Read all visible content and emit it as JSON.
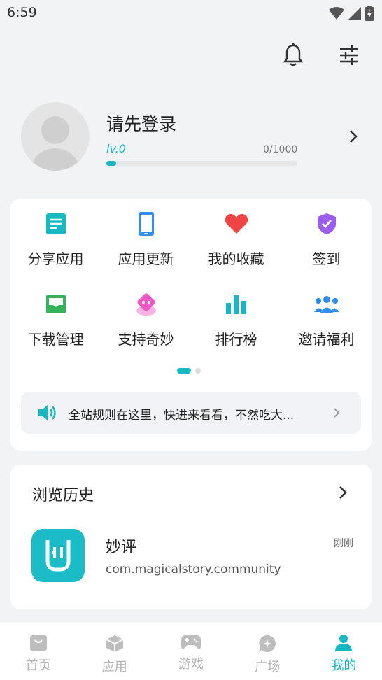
{
  "status": {
    "time": "6:59"
  },
  "profile": {
    "name": "请先登录",
    "level": "lv.0",
    "exp": "0/1000",
    "progress": 0.05
  },
  "grid": {
    "items": [
      {
        "label": "分享应用",
        "icon": "share-doc-icon",
        "color": "#16b8c3"
      },
      {
        "label": "应用更新",
        "icon": "phone-icon",
        "color": "#2f8ef0"
      },
      {
        "label": "我的收藏",
        "icon": "heart-icon",
        "color": "#f04545"
      },
      {
        "label": "签到",
        "icon": "check-badge-icon",
        "color": "#9b5cf0"
      },
      {
        "label": "下载管理",
        "icon": "download-tray-icon",
        "color": "#34b35b"
      },
      {
        "label": "支持奇妙",
        "icon": "gift-icon",
        "color": "#ee58c4"
      },
      {
        "label": "排行榜",
        "icon": "bar-chart-icon",
        "color": "#16b8c3"
      },
      {
        "label": "邀请福利",
        "icon": "group-icon",
        "color": "#2f8ef0"
      }
    ]
  },
  "notice": {
    "text": "全站规则在这里，快进来看看，不然吃大..."
  },
  "history": {
    "title": "浏览历史",
    "items": [
      {
        "name": "妙评",
        "package": "com.magicalstory.community",
        "time": "刚刚"
      }
    ]
  },
  "tabs": [
    {
      "label": "首页",
      "icon": "home-icon"
    },
    {
      "label": "应用",
      "icon": "cube-icon"
    },
    {
      "label": "游戏",
      "icon": "gamepad-icon"
    },
    {
      "label": "广场",
      "icon": "chat-icon"
    },
    {
      "label": "我的",
      "icon": "person-icon",
      "active": true
    }
  ],
  "colors": {
    "accent": "#16b8c3"
  }
}
